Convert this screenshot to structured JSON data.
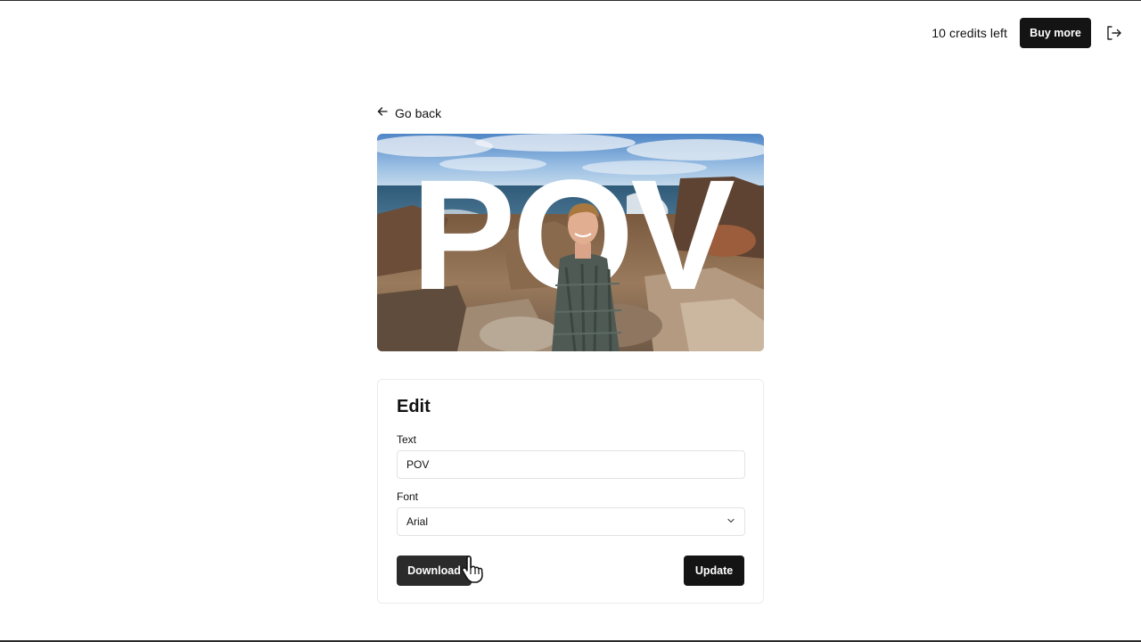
{
  "header": {
    "credits_text": "10 credits left",
    "buy_label": "Buy more",
    "logout_icon": "logout-icon"
  },
  "nav": {
    "back_label": "Go back",
    "back_icon": "arrow-left-icon"
  },
  "preview": {
    "overlay_text": "POV"
  },
  "edit": {
    "title": "Edit",
    "text_label": "Text",
    "text_value": "POV",
    "font_label": "Font",
    "font_value": "Arial",
    "download_label": "Download",
    "update_label": "Update"
  },
  "colors": {
    "button_dark": "#141414",
    "background": "#ffffff"
  }
}
